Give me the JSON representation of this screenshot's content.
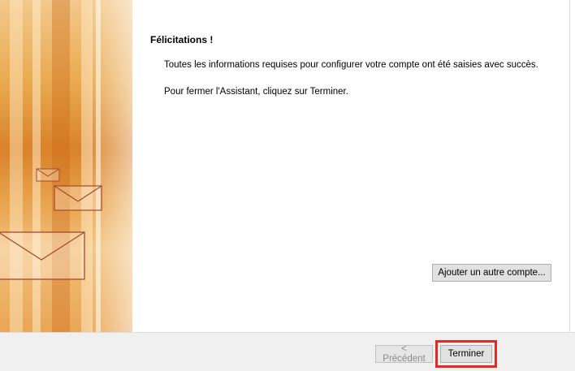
{
  "wizard": {
    "heading": "Félicitations !",
    "message_success": "Toutes les informations requises pour configurer votre compte ont été saisies avec succès.",
    "message_close": "Pour fermer l'Assistant, cliquez sur Terminer.",
    "add_account_label": "Ajouter un autre compte..."
  },
  "footer": {
    "previous_label": "< Précédent",
    "finish_label": "Terminer"
  },
  "banner": {
    "icons": [
      "envelope-icon",
      "envelope-icon",
      "envelope-icon"
    ]
  },
  "colors": {
    "highlight": "#e52a25",
    "banner_orange": "#d9822a"
  }
}
